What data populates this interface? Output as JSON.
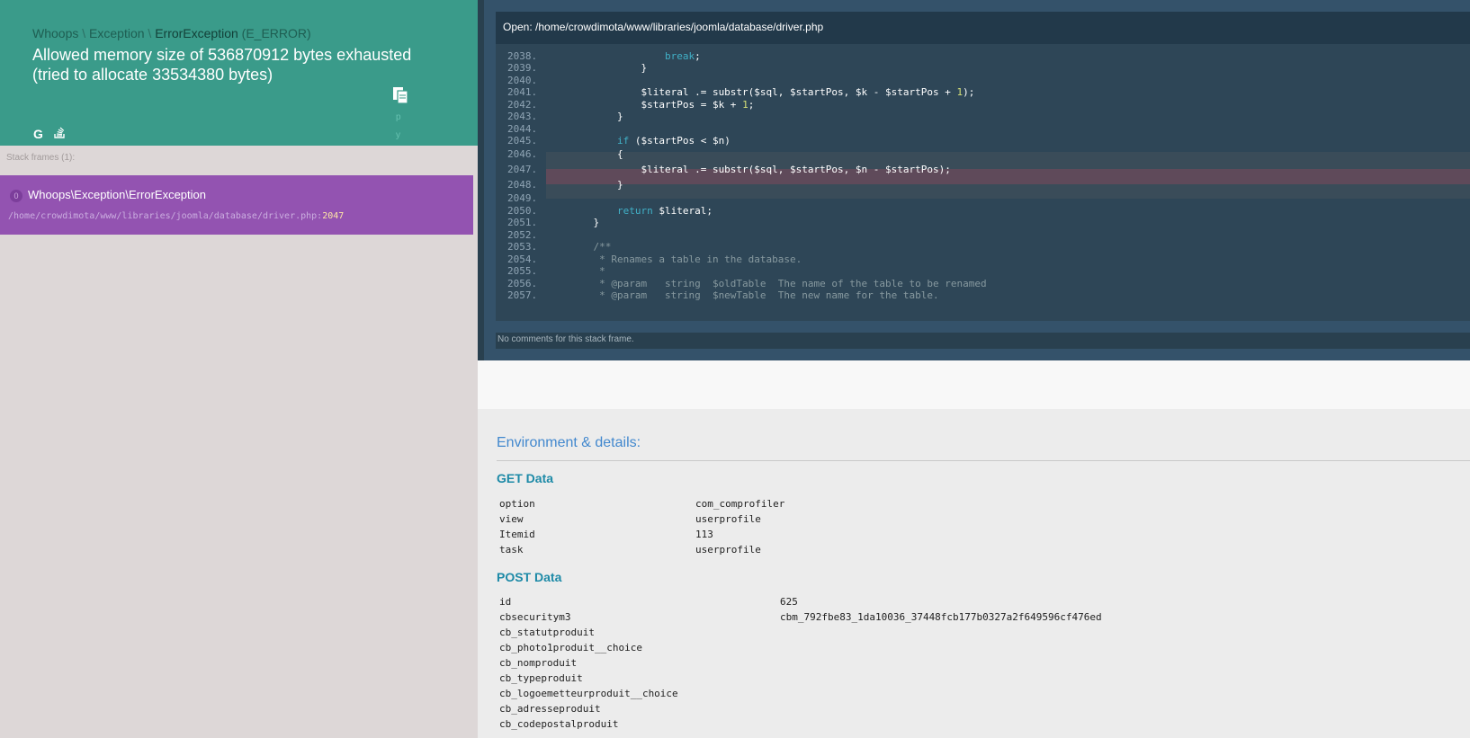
{
  "header": {
    "exception_parts": [
      "Whoops",
      "Exception",
      "ErrorException"
    ],
    "exception_separator": " \\ ",
    "exception_code": "(E_ERROR)",
    "message": "Allowed memory size of 536870912 bytes exhausted (tried to allocate 33534380 bytes)",
    "copy_hint_p": "p",
    "copy_hint_y": "y",
    "google_letter": "G"
  },
  "stack": {
    "label": "Stack frames (1):",
    "frames": [
      {
        "index": "0",
        "class": "Whoops\\Exception\\ErrorException",
        "file": "/home/crowdimota/www/libraries/joomla/database/driver.php",
        "line_sep": ":",
        "line": "2047"
      }
    ]
  },
  "code": {
    "open_label": "Open: /home/crowdimota/www/libraries/joomla/database/driver.php",
    "lines": [
      {
        "num": "2038.",
        "text": "                break;"
      },
      {
        "num": "2039.",
        "text": "            }"
      },
      {
        "num": "2040.",
        "text": ""
      },
      {
        "num": "2041.",
        "text": "            $literal .= substr($sql, $startPos, $k - $startPos + 1);"
      },
      {
        "num": "2042.",
        "text": "            $startPos = $k + 1;"
      },
      {
        "num": "2043.",
        "text": "        }"
      },
      {
        "num": "2044.",
        "text": ""
      },
      {
        "num": "2045.",
        "text": "        if ($startPos < $n)"
      },
      {
        "num": "2046.",
        "text": "        {"
      },
      {
        "num": "2047.",
        "text": "            $literal .= substr($sql, $startPos, $n - $startPos);"
      },
      {
        "num": "2048.",
        "text": "        }"
      },
      {
        "num": "2049.",
        "text": ""
      },
      {
        "num": "2050.",
        "text": "        return $literal;"
      },
      {
        "num": "2051.",
        "text": "    }"
      },
      {
        "num": "2052.",
        "text": ""
      },
      {
        "num": "2053.",
        "text": "    /**"
      },
      {
        "num": "2054.",
        "text": "     * Renames a table in the database."
      },
      {
        "num": "2055.",
        "text": "     *"
      },
      {
        "num": "2056.",
        "text": "     * @param   string  $oldTable  The name of the table to be renamed"
      },
      {
        "num": "2057.",
        "text": "     * @param   string  $newTable  The new name for the table."
      }
    ],
    "comments_label": "No comments for this stack frame."
  },
  "details": {
    "title": "Environment & details:",
    "get": {
      "title": "GET Data",
      "rows": [
        {
          "key": "option",
          "value": "com_comprofiler"
        },
        {
          "key": "view",
          "value": "userprofile"
        },
        {
          "key": "Itemid",
          "value": "113"
        },
        {
          "key": "task",
          "value": "userprofile"
        }
      ]
    },
    "post": {
      "title": "POST Data",
      "rows": [
        {
          "key": "id",
          "value": "625"
        },
        {
          "key": "cbsecuritym3",
          "value": "cbm_792fbe83_1da10036_37448fcb177b0327a2f649596cf476ed"
        },
        {
          "key": "cb_statutproduit",
          "value": ""
        },
        {
          "key": "cb_photo1produit__choice",
          "value": ""
        },
        {
          "key": "cb_nomproduit",
          "value": ""
        },
        {
          "key": "cb_typeproduit",
          "value": ""
        },
        {
          "key": "cb_logoemetteurproduit__choice",
          "value": ""
        },
        {
          "key": "cb_adresseproduit",
          "value": ""
        },
        {
          "key": "cb_codepostalproduit",
          "value": ""
        }
      ]
    }
  }
}
